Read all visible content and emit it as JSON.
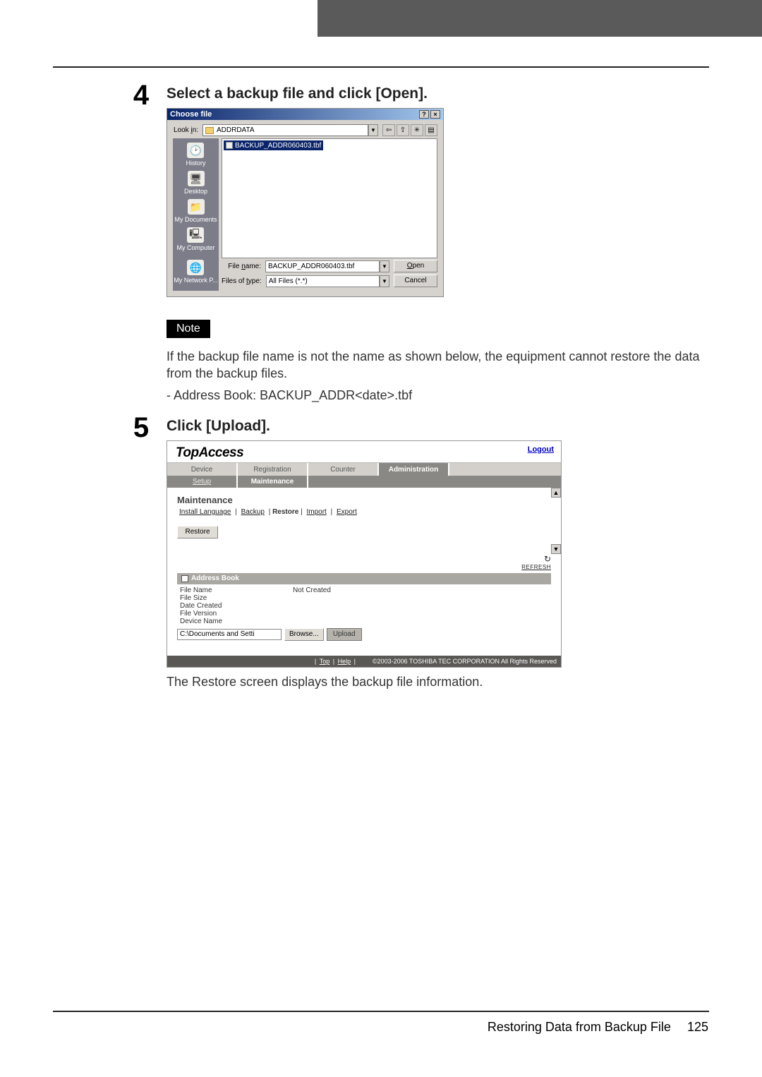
{
  "step4": {
    "number": "4",
    "title": "Select a backup file and click [Open]."
  },
  "winDialog": {
    "title": "Choose file",
    "lookInLabel": "Look in:",
    "lookIn_u": "i",
    "lookInFolder": "ADDRDATA",
    "sidebar": [
      "History",
      "Desktop",
      "My Documents",
      "My Computer",
      "My Network P..."
    ],
    "selectedFile": "BACKUP_ADDR060403.tbf",
    "fileNameLabel": "File name:",
    "fileName_u": "n",
    "fileName": "BACKUP_ADDR060403.tbf",
    "fileTypeLabel": "Files of type:",
    "fileType_u": "t",
    "fileType": "All Files (*.*)",
    "openLabel": "Open",
    "open_u": "O",
    "cancelLabel": "Cancel"
  },
  "note": {
    "label": "Note",
    "text": "If the backup file name is not the name as shown below, the equipment cannot restore the data from the backup files.",
    "bullet": "- Address Book: BACKUP_ADDR<date>.tbf"
  },
  "step5": {
    "number": "5",
    "title": "Click [Upload].",
    "caption": "The Restore screen displays the backup file information."
  },
  "webui": {
    "logo": "TopAccess",
    "logout": "Logout",
    "tabs": [
      "Device",
      "Registration",
      "Counter",
      "Administration"
    ],
    "activeTab": 3,
    "subtabs": [
      "Setup",
      "Maintenance"
    ],
    "activeSubtab": 1,
    "maintTitle": "Maintenance",
    "maintLinks": [
      "Install Language",
      "Backup",
      "Restore",
      "Import",
      "Export"
    ],
    "maintActive": 2,
    "restoreBtn": "Restore",
    "refresh": "REFRESH",
    "addressBook": {
      "title": "Address Book",
      "rows": [
        {
          "label": "File Name",
          "value": "Not Created"
        },
        {
          "label": "File Size",
          "value": ""
        },
        {
          "label": "Date Created",
          "value": ""
        },
        {
          "label": "File Version",
          "value": ""
        },
        {
          "label": "Device Name",
          "value": ""
        }
      ]
    },
    "path": "C:\\Documents and Setti",
    "browseBtn": "Browse...",
    "uploadBtn": "Upload",
    "footerLinks": [
      "Top",
      "Help"
    ],
    "copyright": "©2003-2006 TOSHIBA TEC CORPORATION All Rights Reserved"
  },
  "footer": {
    "text": "Restoring Data from Backup File",
    "page": "125"
  }
}
